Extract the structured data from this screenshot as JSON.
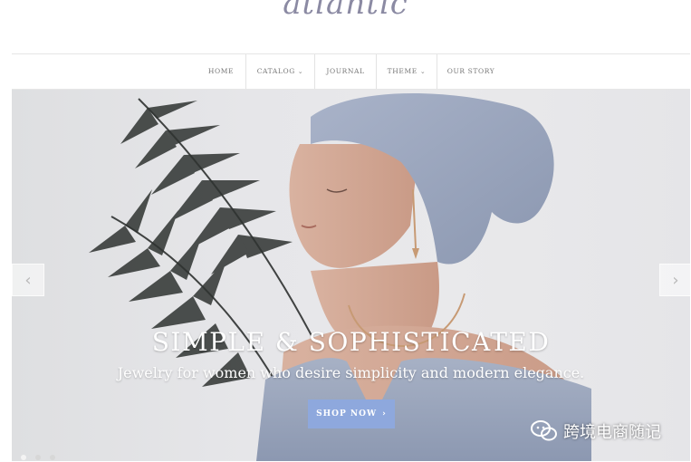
{
  "brand": {
    "logo": "atlantic"
  },
  "nav": {
    "items": [
      {
        "label": "HOME"
      },
      {
        "label": "CATALOG"
      },
      {
        "label": "JOURNAL"
      },
      {
        "label": "THEME"
      },
      {
        "label": "OUR STORY"
      }
    ]
  },
  "hero": {
    "headline": "SIMPLE & SOPHISTICATED",
    "subline": "Jewelry for women who desire simplicity and modern elegance.",
    "cta_label": "SHOP NOW",
    "cta_icon": "chevron-right-icon",
    "prev_icon": "chevron-left-icon",
    "next_icon": "chevron-right-icon",
    "slides": 3,
    "active_slide": 1
  },
  "watermark": {
    "text": "跨境电商随记",
    "icon": "wechat-icon"
  },
  "colors": {
    "accent": "#8ea8dd",
    "logo": "#8b8aa3",
    "nav_text": "#777777"
  }
}
